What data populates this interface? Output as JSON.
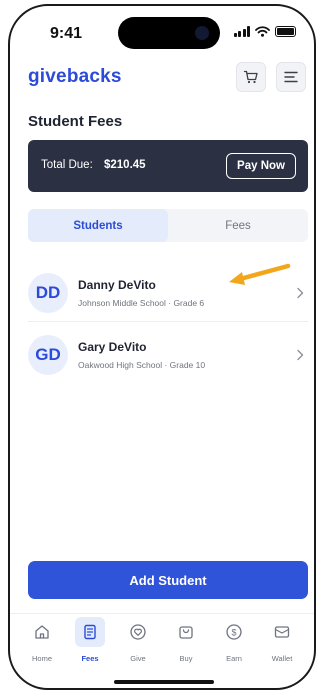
{
  "status_bar": {
    "time": "9:41"
  },
  "header": {
    "brand": "givebacks",
    "cart_icon": "cart-icon",
    "menu_icon": "menu-icon"
  },
  "page": {
    "title": "Student Fees"
  },
  "due": {
    "label": "Total Due:",
    "amount": "$210.45",
    "pay_label": "Pay Now"
  },
  "tabs": [
    {
      "label": "Students",
      "active": true
    },
    {
      "label": "Fees",
      "active": false
    }
  ],
  "students": [
    {
      "initials": "DD",
      "name": "Danny DeVito",
      "meta": "Johnson Middle School · Grade 6"
    },
    {
      "initials": "GD",
      "name": "Gary DeVito",
      "meta": "Oakwood High School · Grade 10"
    }
  ],
  "actions": {
    "add_student": "Add Student"
  },
  "nav": [
    {
      "label": "Home",
      "icon": "home-icon",
      "active": false
    },
    {
      "label": "Fees",
      "icon": "receipt-icon",
      "active": true
    },
    {
      "label": "Give",
      "icon": "heart-icon",
      "active": false
    },
    {
      "label": "Buy",
      "icon": "bag-icon",
      "active": false
    },
    {
      "label": "Earn",
      "icon": "dollar-icon",
      "active": false
    },
    {
      "label": "Wallet",
      "icon": "wallet-icon",
      "active": false
    }
  ],
  "colors": {
    "brand": "#2c4bd8",
    "banner": "#2b3142",
    "primary_button": "#2f53d9",
    "annotation_arrow": "#f2a71b"
  }
}
